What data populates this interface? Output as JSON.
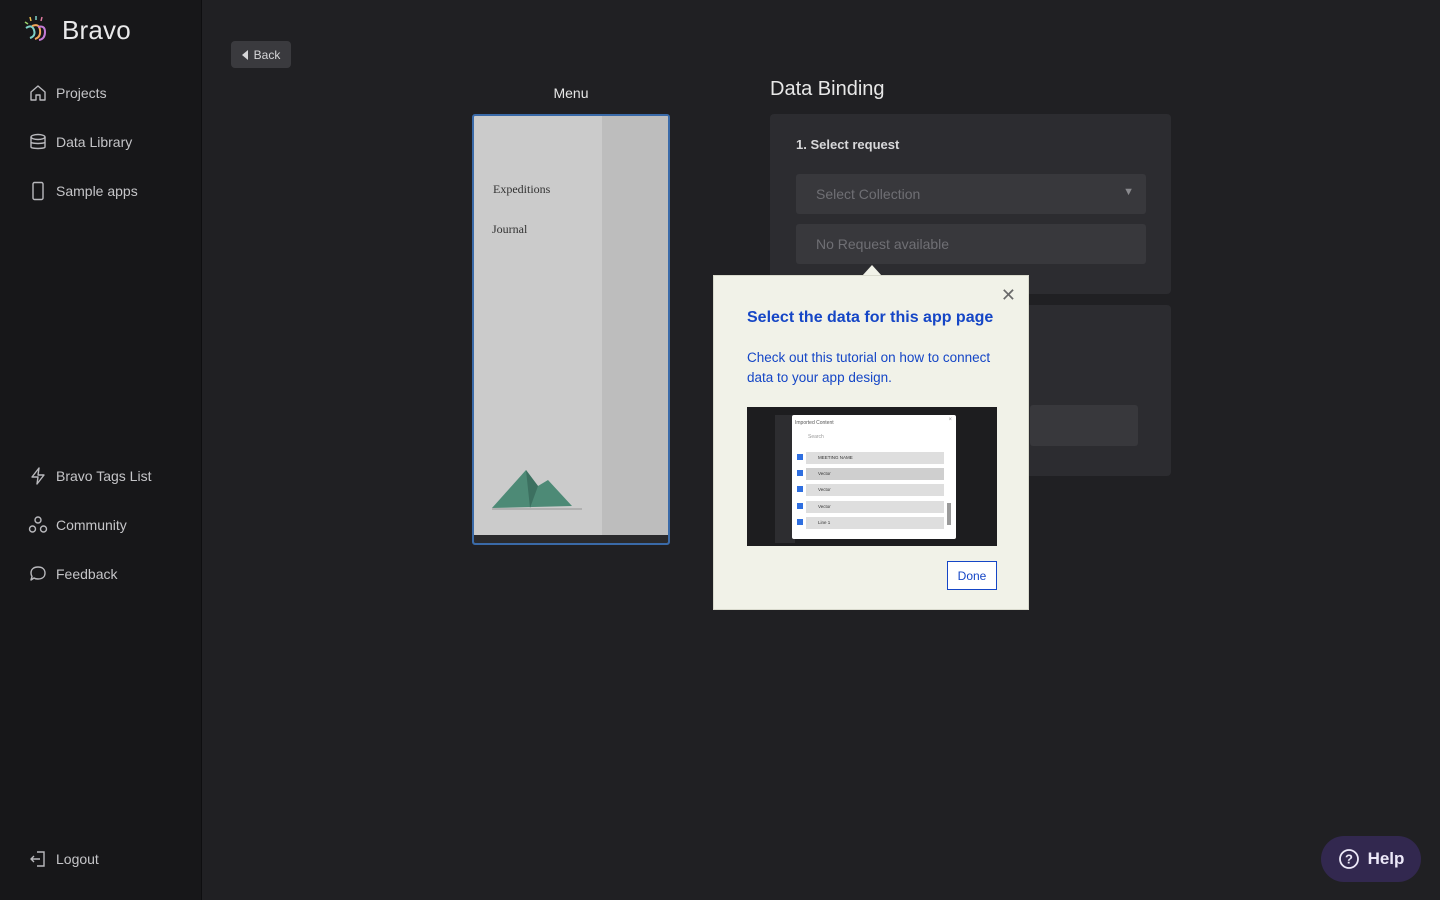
{
  "brand": {
    "name": "Bravo"
  },
  "sidebar": {
    "top_items": [
      {
        "label": "Projects",
        "icon": "home-icon"
      },
      {
        "label": "Data Library",
        "icon": "database-icon"
      },
      {
        "label": "Sample apps",
        "icon": "phone-icon"
      }
    ],
    "bottom_items": [
      {
        "label": "Bravo Tags List",
        "icon": "lightning-icon"
      },
      {
        "label": "Community",
        "icon": "community-icon"
      },
      {
        "label": "Feedback",
        "icon": "chat-icon"
      }
    ],
    "logout": {
      "label": "Logout",
      "icon": "logout-icon"
    }
  },
  "toolbar": {
    "back_label": "Back"
  },
  "preview": {
    "label": "Menu",
    "menu_items": [
      "Expeditions",
      "Journal"
    ]
  },
  "data_binding": {
    "title": "Data Binding",
    "step1_heading": "1. Select request",
    "collection_placeholder": "Select Collection",
    "request_placeholder": "No Request available"
  },
  "tutorial_popover": {
    "title": "Select the data for this app page",
    "body": "Check out this tutorial on how to connect data to your app design.",
    "done_label": "Done",
    "thumbnail": {
      "dialog_title": "Imported Content",
      "search": "Search",
      "rows": [
        "MEETING NAME",
        "Vector",
        "Vector",
        "Vector",
        "Line 1"
      ]
    }
  },
  "help": {
    "label": "Help"
  },
  "colors": {
    "accent_blue": "#1546c6",
    "popover_bg": "#f1f2e8",
    "sidebar_bg": "#171719",
    "main_bg": "#202023",
    "help_bg": "#32284f"
  }
}
